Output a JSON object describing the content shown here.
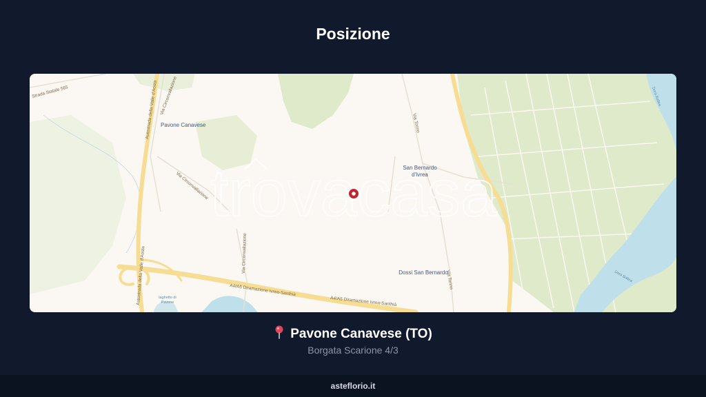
{
  "title": "Posizione",
  "map": {
    "places": {
      "pavone": "Pavone Canavese",
      "san_bernardo_line1": "San Bernardo",
      "san_bernardo_line2": "d'Ivrea",
      "dossi": "Dossi San Bernardo",
      "laghetto_line1": "laghetto di",
      "laghetto_line2": "Pavone",
      "dora_baltea": "Dora Baltea",
      "dora_baltea_2": "Dora Baltea"
    },
    "roads": {
      "a4_5_left": "A4/A5 Diramazione Ivrea-Santhià",
      "a4_5_right": "A4/A5 Diramazione Ivrea-Santhià",
      "autostrada_top": "Autostrada della Valle d'Aosta",
      "autostrada_bottom": "Autostrada della Valle d'Aosta",
      "circonvallazione_1": "Via Circonvallazione",
      "circonvallazione_2": "Via Circonvallazione",
      "circonvallazione_3": "Via Circonvallazione",
      "via_torino_1": "Via Torino",
      "via_torino_2": "Via Torino",
      "strada_statale": "Strada Statale 565"
    },
    "watermark": "trovacasa",
    "colors": {
      "land": "#fbf7f2",
      "green": "#dfeacb",
      "water": "#bfe0ea",
      "highway": "#f6dd93",
      "marker": "#c0262d"
    }
  },
  "location": {
    "city": "Pavone Canavese (TO)",
    "address": "Borgata Scarione 4/3",
    "pin_icon": "pushpin-icon"
  },
  "footer": {
    "brand": "asteflorio.it"
  }
}
